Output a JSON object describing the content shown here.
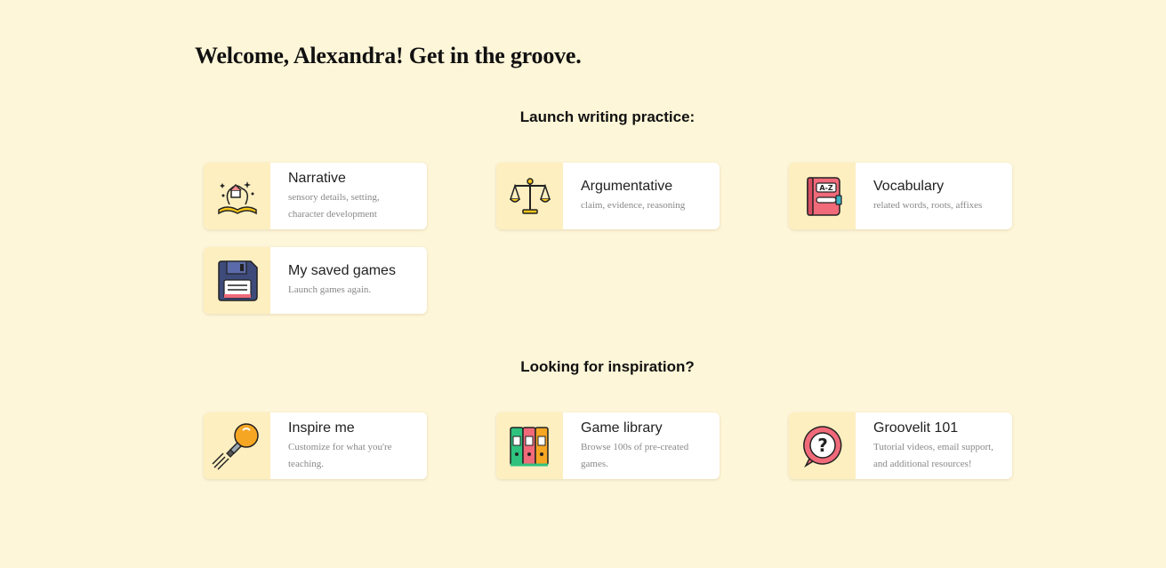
{
  "welcome": "Welcome, Alexandra! Get in the groove.",
  "practice": {
    "heading": "Launch writing practice:",
    "cards": [
      {
        "title": "Narrative",
        "desc": "sensory details, setting, character development",
        "icon": "open-book-icon"
      },
      {
        "title": "Argumentative",
        "desc": "claim, evidence, reasoning",
        "icon": "scales-icon"
      },
      {
        "title": "Vocabulary",
        "desc": "related words, roots, affixes",
        "icon": "dictionary-icon"
      },
      {
        "title": "My saved games",
        "desc": "Launch games again.",
        "icon": "floppy-disk-icon"
      }
    ]
  },
  "inspiration": {
    "heading": "Looking for inspiration?",
    "cards": [
      {
        "title": "Inspire me",
        "desc": "Customize for what you're teaching.",
        "icon": "lightbulb-icon"
      },
      {
        "title": "Game library",
        "desc": "Browse 100s of pre-created games.",
        "icon": "bookshelf-icon"
      },
      {
        "title": "Groovelit 101",
        "desc": "Tutorial videos, email support, and additional resources!",
        "icon": "question-bubble-icon"
      }
    ]
  },
  "colors": {
    "background": "#fef6d8",
    "icon_tile": "#fdefc0"
  }
}
